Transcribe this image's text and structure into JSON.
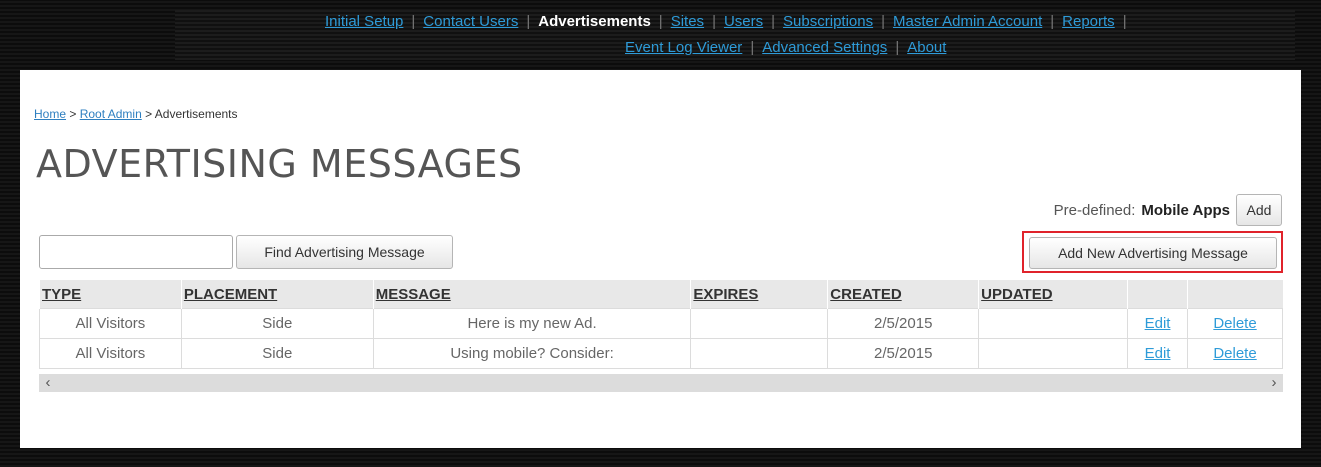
{
  "nav": {
    "row1": [
      {
        "label": "Initial Setup",
        "active": false
      },
      {
        "label": "Contact Users",
        "active": false
      },
      {
        "label": "Advertisements",
        "active": true
      },
      {
        "label": "Sites",
        "active": false
      },
      {
        "label": "Users",
        "active": false
      },
      {
        "label": "Subscriptions",
        "active": false
      },
      {
        "label": "Master Admin Account",
        "active": false
      },
      {
        "label": "Reports",
        "active": false
      }
    ],
    "row2": [
      {
        "label": "Event Log Viewer",
        "active": false
      },
      {
        "label": "Advanced Settings",
        "active": false
      },
      {
        "label": "About",
        "active": false
      }
    ]
  },
  "breadcrumb": {
    "home": "Home",
    "root_admin": "Root Admin",
    "current": "Advertisements",
    "separator": ">"
  },
  "page_title": "ADVERTISING MESSAGES",
  "predefined": {
    "label": "Pre-defined:",
    "value": "Mobile Apps",
    "add_label": "Add"
  },
  "search": {
    "value": "",
    "placeholder": "",
    "button_label": "Find Advertising Message"
  },
  "add_new_label": "Add New Advertising Message",
  "table": {
    "headers": [
      "TYPE",
      "PLACEMENT",
      "MESSAGE",
      "EXPIRES",
      "CREATED",
      "UPDATED",
      "",
      ""
    ],
    "rows": [
      {
        "type": "All Visitors",
        "placement": "Side",
        "message": "Here is my new Ad.",
        "expires": "",
        "created": "2/5/2015",
        "updated": "",
        "edit": "Edit",
        "delete": "Delete"
      },
      {
        "type": "All Visitors",
        "placement": "Side",
        "message": "Using mobile? Consider:",
        "expires": "",
        "created": "2/5/2015",
        "updated": "",
        "edit": "Edit",
        "delete": "Delete"
      }
    ]
  },
  "scroll": {
    "left_icon": "chevron-left-icon",
    "right_icon": "chevron-right-icon"
  },
  "colors": {
    "link": "#2e9bd8",
    "highlight": "#e0232b"
  }
}
